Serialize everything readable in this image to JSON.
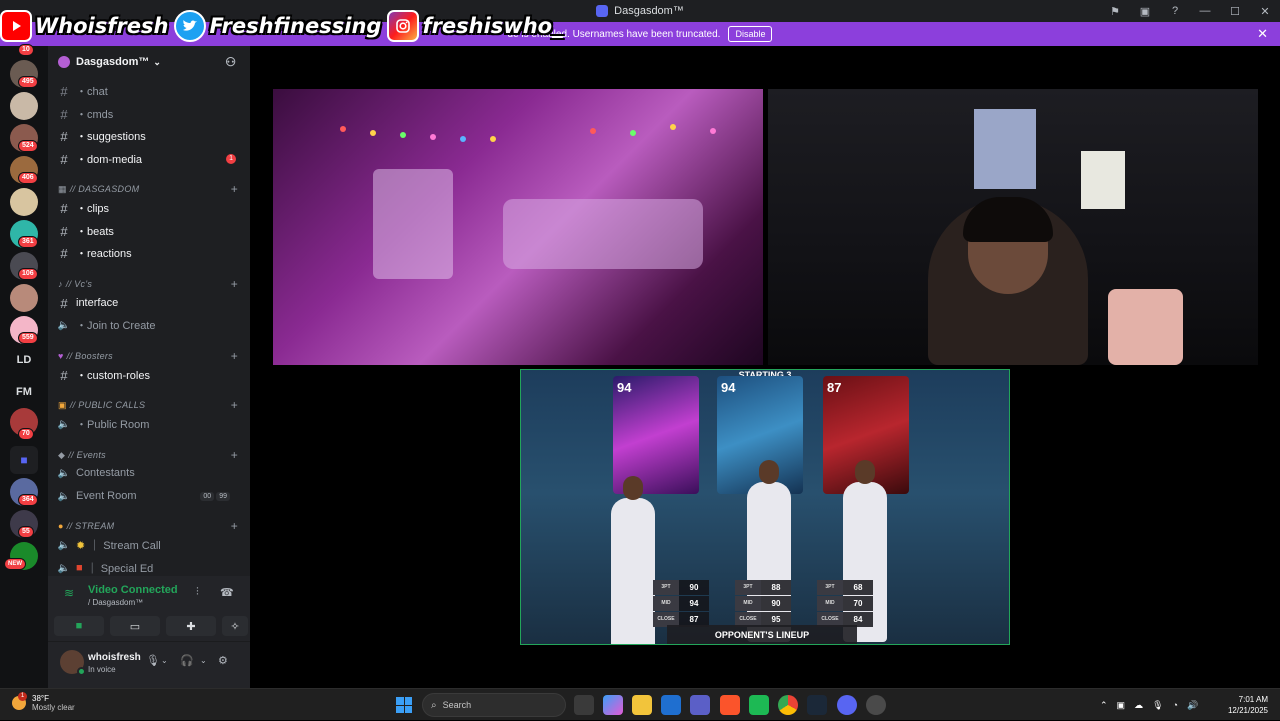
{
  "window": {
    "title": "Dasgasdom™"
  },
  "overlay": {
    "youtube": "Whoisfresh",
    "twitter": "Freshfinessing",
    "instagram": "freshiswho_"
  },
  "banner": {
    "text": "de is enabled. Usernames have been truncated.",
    "disable_label": "Disable"
  },
  "guilds": {
    "badges": [
      "10",
      "495",
      "524",
      "406",
      "361",
      "106",
      "559",
      "70",
      "364",
      "55"
    ],
    "text_icons": [
      "LD",
      "FM"
    ],
    "new_label": "NEW"
  },
  "server": {
    "name": "Dasgasdom™"
  },
  "channels": {
    "chat": "・chat",
    "cmds": "・cmds",
    "suggestions": "・suggestions",
    "dom_media": "・dom-media",
    "dom_media_badge": "1",
    "cat_dasgasdom": "// DASGASDOM",
    "clips": "・clips",
    "beats": "・beats",
    "reactions": "・reactions",
    "cat_vcs": "// Vc's",
    "interface": "interface",
    "join_to_create": "・Join to Create",
    "cat_boosters": "// Boosters",
    "custom_roles": "・custom-roles",
    "cat_public": "// PUBLIC CALLS",
    "public_room": "・Public Room",
    "cat_events": "// Events",
    "contestants": "Contestants",
    "event_room": "Event Room",
    "event_counts": [
      "00",
      "99"
    ],
    "cat_stream": "// STREAM",
    "stream_call": "｜ Stream Call",
    "special_ed": "｜ Special Ed"
  },
  "voice": {
    "status": "Video Connected",
    "location": "/ Dasgasdom™"
  },
  "user": {
    "name": "whoisfresh",
    "status": "In voice"
  },
  "game": {
    "title": "STARTING 3",
    "cards": [
      {
        "ovr": "94",
        "color": "#7a2f9a"
      },
      {
        "ovr": "94",
        "color": "#3d8fc4"
      },
      {
        "ovr": "87",
        "color": "#b8262e"
      }
    ],
    "stat_labels": [
      "3PT",
      "MID",
      "CLOSE"
    ],
    "stats": [
      [
        "90",
        "94",
        "87"
      ],
      [
        "88",
        "90",
        "95"
      ],
      [
        "68",
        "70",
        "84"
      ]
    ],
    "footer": "OPPONENT'S LINEUP"
  },
  "taskbar": {
    "temp": "38°F",
    "condition": "Mostly clear",
    "weather_badge": "1",
    "search": "Search",
    "time": "7:01 AM",
    "date": "12/21/2025"
  }
}
